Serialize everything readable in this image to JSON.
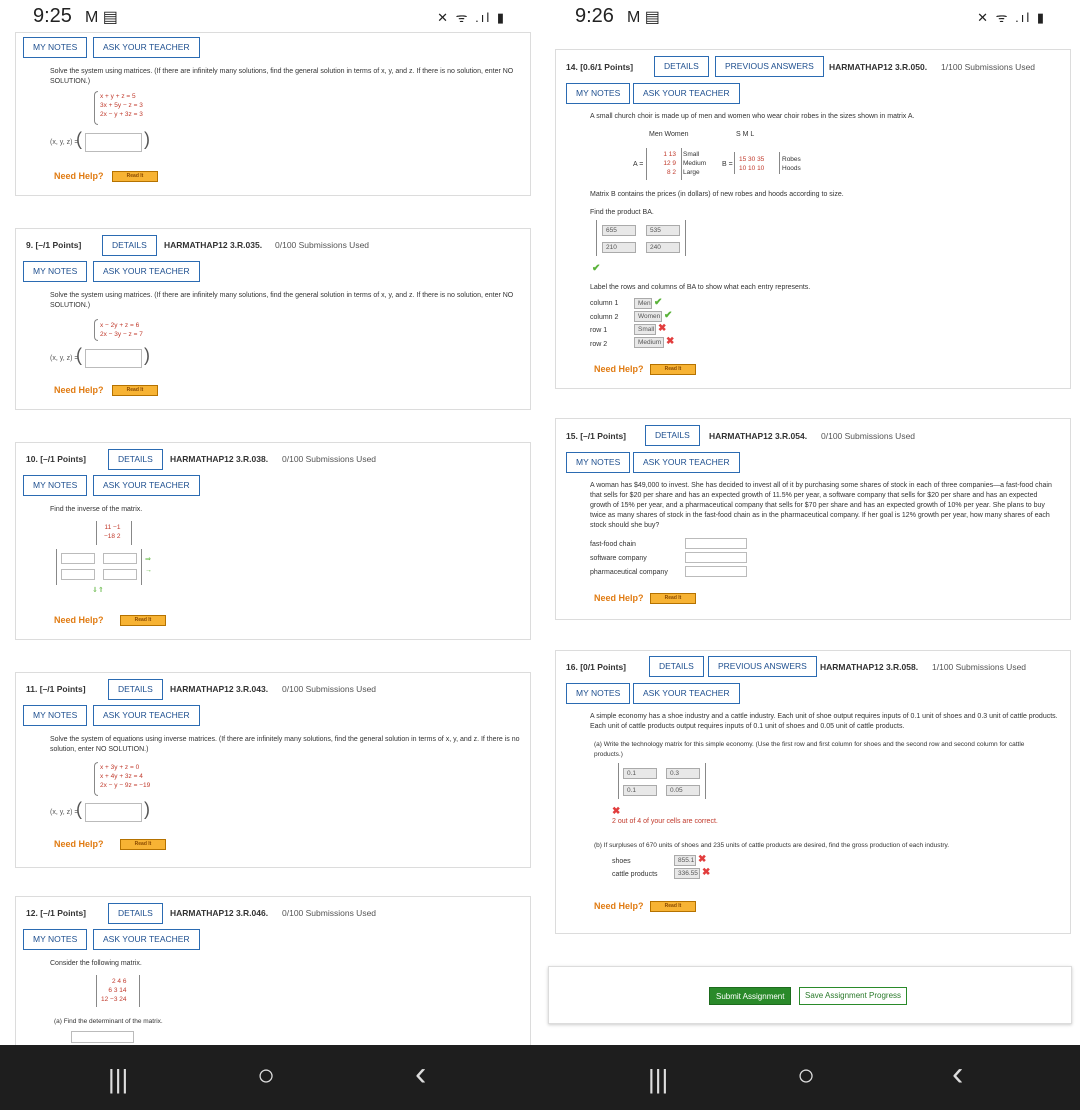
{
  "left": {
    "status": {
      "time": "9:25",
      "icons": "✕ ᯤ .ıl ▮"
    },
    "buttons": {
      "my_notes": "MY NOTES",
      "ask": "ASK YOUR TEACHER",
      "details": "DETAILS"
    },
    "q8": {
      "prompt": "Solve the system using matrices. (If there are infinitely many solutions, find the general solution in terms of x, y, and z. If there is no solution, enter NO SOLUTION.)",
      "eqs": [
        "x +  y +  z = 5",
        "3x + 5y −   z = 3",
        "2x −   y + 3z = 3"
      ],
      "answer_label": "(x, y, z) ="
    },
    "need_help": "Need Help?",
    "read_it": "Read It",
    "q9": {
      "num": "9.",
      "points": "[–/1 Points]",
      "code": "HARMATHAP12 3.R.035.",
      "subs": "0/100 Submissions Used",
      "prompt": "Solve the system using matrices. (If there are infinitely many solutions, find the general solution in terms of x, y, and z. If there is no solution, enter NO SOLUTION.)",
      "eqs": [
        "x −  2y +  z = 6",
        "2x −  3y −  z = 7"
      ],
      "answer_label": "(x, y, z) ="
    },
    "q10": {
      "num": "10.",
      "points": "[–/1 Points]",
      "code": "HARMATHAP12 3.R.038.",
      "subs": "0/100 Submissions Used",
      "prompt": "Find the inverse of the matrix.",
      "matrix": [
        "11  −1",
        "−18   2"
      ]
    },
    "q11": {
      "num": "11.",
      "points": "[–/1 Points]",
      "code": "HARMATHAP12 3.R.043.",
      "subs": "0/100 Submissions Used",
      "prompt": "Solve the system of equations using inverse matrices. (If there are infinitely many solutions, find the general solution in terms of x, y, and z. If there is no solution, enter NO SOLUTION.)",
      "eqs": [
        "x + 3y +  z =    0",
        "x + 4y + 3z =    4",
        "2x −   y −  9z = −19"
      ],
      "answer_label": "(x, y, z) ="
    },
    "q12": {
      "num": "12.",
      "points": "[–/1 Points]",
      "code": "HARMATHAP12 3.R.046.",
      "subs": "0/100 Submissions Used",
      "prompt": "Consider the following matrix.",
      "matrix": [
        "2   4   6",
        "6   3  14",
        "12  −3  24"
      ],
      "part_a": "(a)    Find the determinant of the matrix."
    }
  },
  "right": {
    "status": {
      "time": "9:26",
      "icons": "✕ ᯤ .ıl ▮"
    },
    "buttons": {
      "my_notes": "MY NOTES",
      "ask": "ASK YOUR TEACHER",
      "details": "DETAILS",
      "prev": "PREVIOUS ANSWERS"
    },
    "q14": {
      "num": "14.",
      "points": "[0.6/1 Points]",
      "code": "HARMATHAP12 3.R.050.",
      "subs": "1/100 Submissions Used",
      "prompt": "A small church choir is made up of men and women who wear choir robes in the sizes shown in matrix A.",
      "a_header": "Men  Women",
      "b_header": "S   M   L",
      "a_rows": [
        "1   13",
        "12   9",
        "8    2"
      ],
      "a_labels": [
        "Small",
        "Medium",
        "Large"
      ],
      "b_rows": [
        "15  30  35",
        "10  10  10"
      ],
      "b_labels": [
        "Robes",
        "Hoods"
      ],
      "a_name": "A =",
      "b_name": "B =",
      "b_desc": "Matrix B contains the prices (in dollars) of new robes and hoods according to size.",
      "find": "Find the product BA.",
      "cells": [
        "655",
        "535",
        "210",
        "240"
      ],
      "label_prompt": "Label the rows and columns of BA to show what each entry represents.",
      "labels": [
        {
          "k": "column 1",
          "v": "Men"
        },
        {
          "k": "column 2",
          "v": "Women"
        },
        {
          "k": "row 1",
          "v": "Small"
        },
        {
          "k": "row 2",
          "v": "Medium"
        }
      ]
    },
    "q15": {
      "num": "15.",
      "points": "[–/1 Points]",
      "code": "HARMATHAP12 3.R.054.",
      "subs": "0/100 Submissions Used",
      "prompt": "A woman has $49,000 to invest. She has decided to invest all of it by purchasing some shares of stock in each of three companies—a fast-food chain that sells for $20 per share and has an expected growth of 11.5% per year, a software company that sells for $20 per share and has an expected growth of 15% per year, and a pharmaceutical company that sells for $70 per share and has an expected growth of 10% per year. She plans to buy twice as many shares of stock in the fast-food chain as in the pharmaceutical company. If her goal is 12% growth per year, how many shares of each stock should she buy?",
      "fields": [
        "fast-food chain",
        "software company",
        "pharmaceutical company"
      ]
    },
    "q16": {
      "num": "16.",
      "points": "[0/1 Points]",
      "code": "HARMATHAP12 3.R.058.",
      "subs": "1/100 Submissions Used",
      "prompt": "A simple economy has a shoe industry and a cattle industry. Each unit of shoe output requires inputs of 0.1 unit of shoes and 0.3 unit of cattle products. Each unit of cattle products output requires inputs of 0.1 unit of shoes and 0.05 unit of cattle products.",
      "part_a": "(a)    Write the technology matrix for this simple economy. (Use the first row and first column for shoes and the second row and second column for cattle products.)",
      "cells": [
        "0.1",
        "0.3",
        "0.1",
        "0.05"
      ],
      "correct_msg": "2 out of 4 of your cells are correct.",
      "part_b": "(b)    If surpluses of 670 units of shoes and 235 units of cattle products are desired, find the gross production of each industry.",
      "b_fields": [
        {
          "k": "shoes",
          "v": "855.1"
        },
        {
          "k": "cattle products",
          "v": "336.55"
        }
      ]
    },
    "submit": "Submit Assignment",
    "save": "Save Assignment Progress"
  },
  "nav": {
    "recent": "|||",
    "home": "○",
    "back": "‹"
  }
}
